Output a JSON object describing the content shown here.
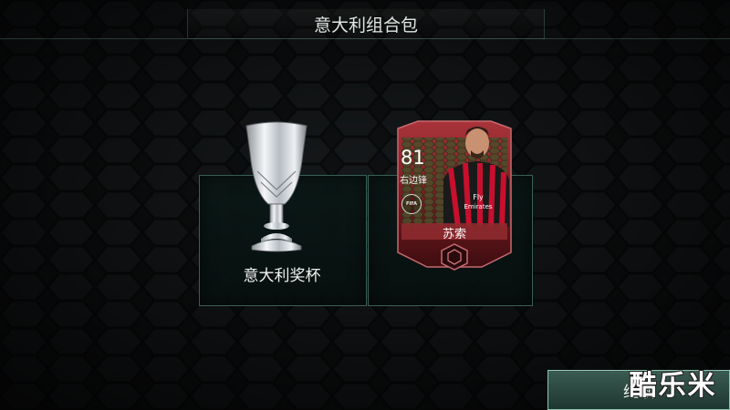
{
  "header": {
    "title": "意大利组合包"
  },
  "rewards": {
    "trophy": {
      "label": "意大利奖杯",
      "icon": "silver-trophy-icon"
    },
    "player_card": {
      "rating": "81",
      "position": "右边锋",
      "name": "苏索",
      "badge_text": "FIFA",
      "card_color": "#7a1f24"
    }
  },
  "footer": {
    "continue_label": "继续"
  },
  "watermark": "酷乐米",
  "colors": {
    "accent": "#8fc6b4",
    "panel_border": "#5fa08c",
    "card_red": "#8e2a2f"
  }
}
